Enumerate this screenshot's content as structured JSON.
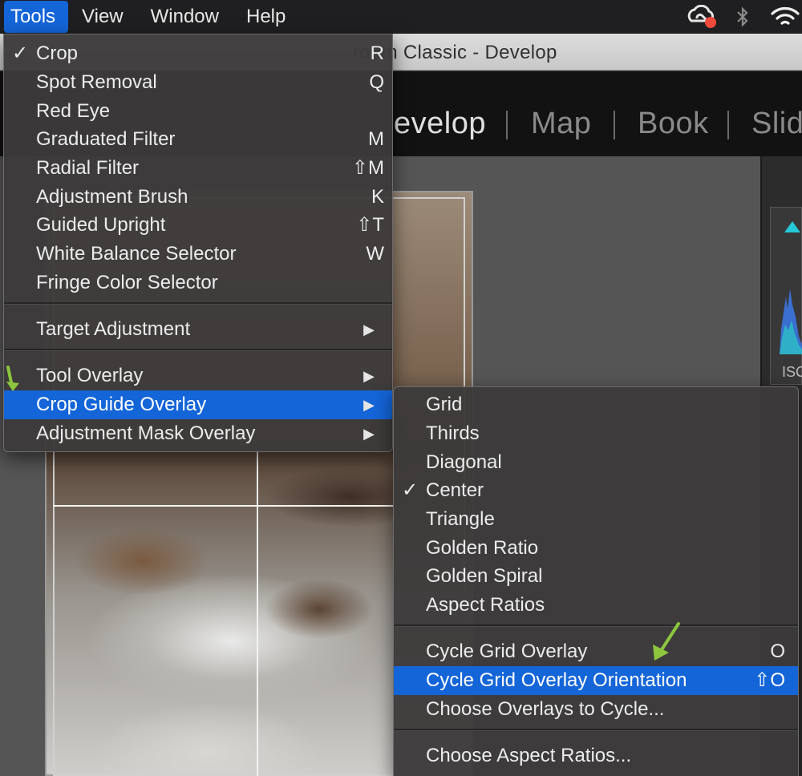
{
  "menubar": {
    "items": [
      "Tools",
      "View",
      "Window",
      "Help"
    ],
    "status_icons": [
      "creative-cloud-icon",
      "bluetooth-icon",
      "wifi-icon"
    ]
  },
  "window": {
    "title": "room Classic - Develop"
  },
  "modules": [
    "evelop",
    "Map",
    "Book",
    "Slid"
  ],
  "right_panel": {
    "iso_label": "ISC"
  },
  "tools_menu": {
    "items": [
      {
        "label": "Crop",
        "shortcut": "R",
        "checked": true
      },
      {
        "label": "Spot Removal",
        "shortcut": "Q"
      },
      {
        "label": "Red Eye",
        "shortcut": ""
      },
      {
        "label": "Graduated Filter",
        "shortcut": "M"
      },
      {
        "label": "Radial Filter",
        "shortcut": "⇧M"
      },
      {
        "label": "Adjustment Brush",
        "shortcut": "K"
      },
      {
        "label": "Guided Upright",
        "shortcut": "⇧T"
      },
      {
        "label": "White Balance Selector",
        "shortcut": "W"
      },
      {
        "label": "Fringe Color Selector",
        "shortcut": ""
      },
      {
        "label": "Target Adjustment",
        "submenu": true
      },
      {
        "label": "Tool Overlay",
        "submenu": true
      },
      {
        "label": "Crop Guide Overlay",
        "submenu": true,
        "highlighted": true
      },
      {
        "label": "Adjustment Mask Overlay",
        "submenu": true
      }
    ]
  },
  "crop_guide_submenu": {
    "items": [
      {
        "label": "Grid"
      },
      {
        "label": "Thirds"
      },
      {
        "label": "Diagonal"
      },
      {
        "label": "Center",
        "checked": true
      },
      {
        "label": "Triangle"
      },
      {
        "label": "Golden Ratio"
      },
      {
        "label": "Golden Spiral"
      },
      {
        "label": "Aspect Ratios"
      },
      {
        "label": "Cycle Grid Overlay",
        "shortcut": "O"
      },
      {
        "label": "Cycle Grid Overlay Orientation",
        "shortcut": "⇧O",
        "highlighted": true
      },
      {
        "label": "Choose Overlays to Cycle..."
      },
      {
        "label": "Choose Aspect Ratios..."
      }
    ]
  },
  "colors": {
    "highlight": "#1465d8",
    "annotation_arrow": "#8cc63f"
  }
}
